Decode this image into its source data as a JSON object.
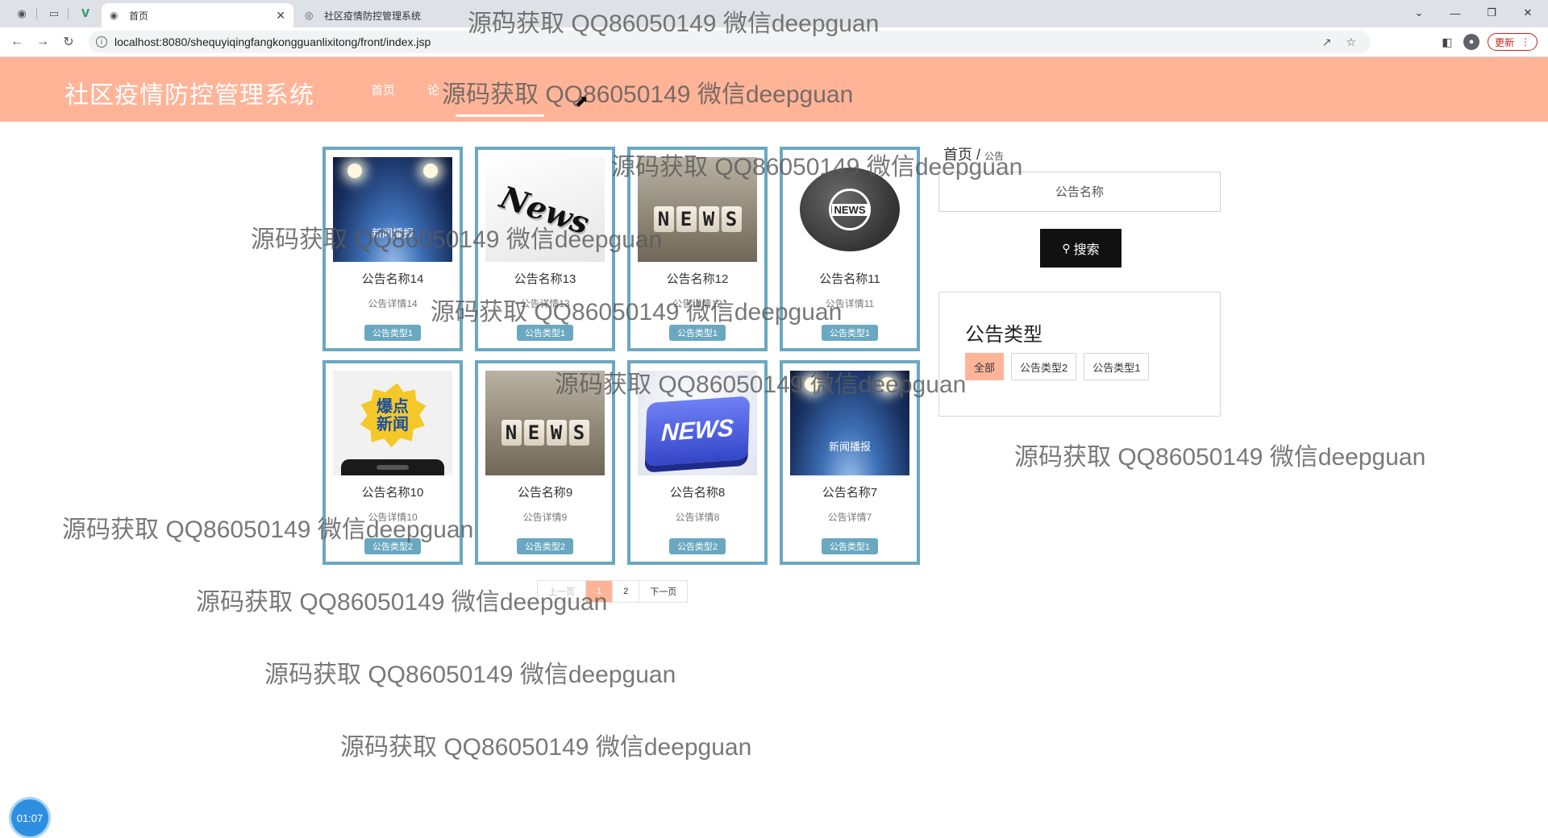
{
  "browser": {
    "tabs": [
      {
        "title": "首页",
        "active": true
      },
      {
        "title": "社区疫情防控管理系统",
        "active": false
      }
    ],
    "url": "localhost:8080/shequyiqingfangkongguanlixitong/front/index.jsp",
    "update_label": "更新",
    "icons": [
      "back-icon",
      "forward-icon",
      "reload-icon",
      "share-icon",
      "star-icon",
      "sidebar-icon",
      "profile-icon",
      "menu-icon"
    ]
  },
  "site": {
    "title": "社区疫情防控管理系统",
    "nav": [
      {
        "label": "首页",
        "active": false
      },
      {
        "label": "论",
        "active": false
      },
      {
        "label": "",
        "active": true
      }
    ],
    "accent_color": "#ffb498",
    "card_border_color": "#6aa8c1"
  },
  "cards": [
    {
      "title": "公告名称14",
      "desc": "公告详情14",
      "tag": "公告类型1",
      "image": "stage",
      "image_text": "新闻播报"
    },
    {
      "title": "公告名称13",
      "desc": "公告详情13",
      "tag": "公告类型1",
      "image": "newspaper",
      "image_text": "News"
    },
    {
      "title": "公告名称12",
      "desc": "公告详情12",
      "tag": "公告类型1",
      "image": "blocks",
      "image_text": "NEWS"
    },
    {
      "title": "公告名称11",
      "desc": "公告详情11",
      "tag": "公告类型1",
      "image": "globe",
      "image_text": "NEWS"
    },
    {
      "title": "公告名称10",
      "desc": "公告详情10",
      "tag": "公告类型2",
      "image": "phone",
      "image_text": "爆点新闻"
    },
    {
      "title": "公告名称9",
      "desc": "公告详情9",
      "tag": "公告类型2",
      "image": "blocks",
      "image_text": "NEWS"
    },
    {
      "title": "公告名称8",
      "desc": "公告详情8",
      "tag": "公告类型2",
      "image": "key",
      "image_text": "NEWS"
    },
    {
      "title": "公告名称7",
      "desc": "公告详情7",
      "tag": "公告类型1",
      "image": "stage",
      "image_text": "新闻播报"
    }
  ],
  "pagination": {
    "prev": "上一页",
    "pages": [
      "1",
      "2"
    ],
    "current": "1",
    "next": "下一页"
  },
  "sidebar": {
    "breadcrumb_home": "首页",
    "breadcrumb_sep": "/",
    "breadcrumb_current": "公告",
    "search_placeholder": "公告名称",
    "search_button": "搜索",
    "type_heading": "公告类型",
    "types": [
      {
        "label": "全部",
        "active": true
      },
      {
        "label": "公告类型2",
        "active": false
      },
      {
        "label": "公告类型1",
        "active": false
      }
    ]
  },
  "timer": "01:07",
  "watermark_text": "源码获取 QQ86050149 微信deepguan"
}
